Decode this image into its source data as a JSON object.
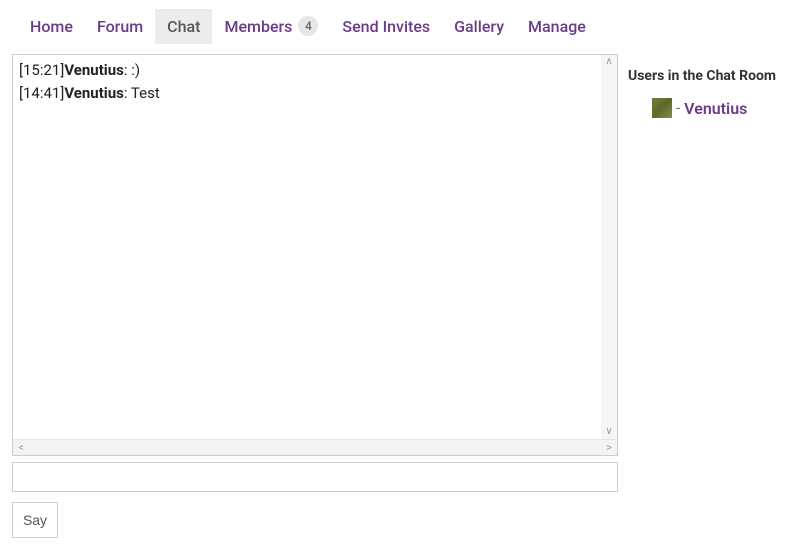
{
  "nav": {
    "home": "Home",
    "forum": "Forum",
    "chat": "Chat",
    "members": "Members",
    "members_count": "4",
    "send_invites": "Send Invites",
    "gallery": "Gallery",
    "manage": "Manage"
  },
  "chat": {
    "messages": [
      {
        "time": "[15:21]",
        "user": "Venutius",
        "sep": ": ",
        "text": ":)"
      },
      {
        "time": "[14:41]",
        "user": "Venutius",
        "sep": ": ",
        "text": "Test"
      }
    ],
    "input_value": "",
    "say_label": "Say"
  },
  "sidebar": {
    "title": "Users in the Chat Room",
    "users": [
      {
        "name": "Venutius"
      }
    ]
  }
}
